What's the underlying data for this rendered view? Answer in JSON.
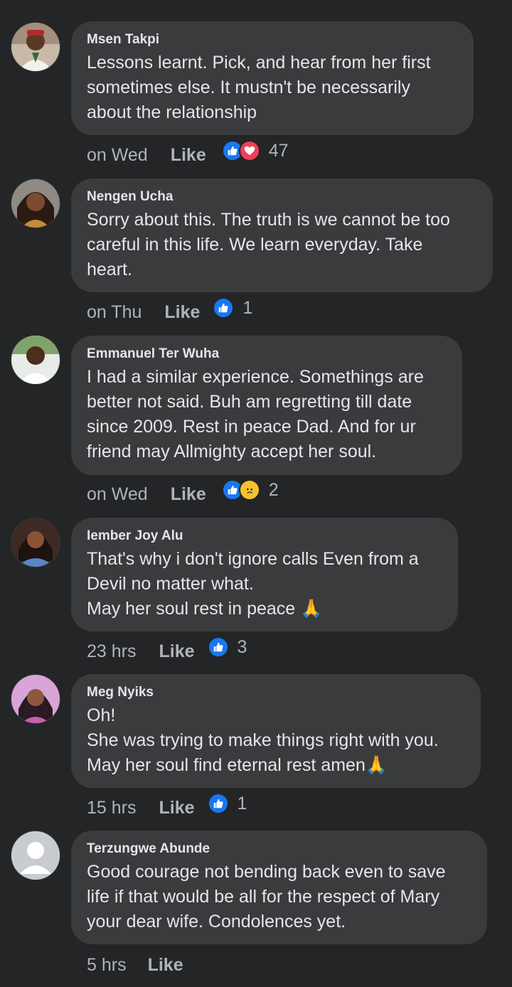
{
  "comments": [
    {
      "author": "Msen Takpi",
      "text": "Lessons learnt. Pick, and hear from her first\nsometimes else. It mustn't be necessarily\nabout the relationship",
      "time": "on Wed",
      "like_label": "Like",
      "reactions": [
        "like-icon",
        "love-icon"
      ],
      "reaction_count": "47"
    },
    {
      "author": "Nengen Ucha",
      "text": "Sorry about this. The truth is we cannot be too\ncareful in this life. We learn everyday. Take\nheart.",
      "time": "on Thu",
      "like_label": "Like",
      "reactions": [
        "like-icon"
      ],
      "reaction_count": "1"
    },
    {
      "author": "Emmanuel Ter Wuha",
      "text": "I had a similar experience. Somethings are\nbetter not said. Buh am regretting till date\nsince 2009. Rest in peace Dad. And for ur\nfriend may Allmighty accept her soul.",
      "time": "on Wed",
      "like_label": "Like",
      "reactions": [
        "like-icon",
        "sad-icon"
      ],
      "reaction_count": "2"
    },
    {
      "author": "Iember Joy Alu",
      "text": "That's why i don't ignore calls Even from a\nDevil no matter what.\nMay her soul rest in peace 🙏",
      "time": "23 hrs",
      "like_label": "Like",
      "reactions": [
        "like-icon"
      ],
      "reaction_count": "3"
    },
    {
      "author": "Meg Nyiks",
      "text": "Oh!\nShe was trying to make things right with you.\nMay her soul find eternal rest amen🙏",
      "time": "15 hrs",
      "like_label": "Like",
      "reactions": [
        "like-icon"
      ],
      "reaction_count": "1"
    },
    {
      "author": "Terzungwe Abunde",
      "text": "Good courage not bending back even to save\nlife if that would be all for the respect of Mary\nyour dear wife. Condolences yet.",
      "time": "5 hrs",
      "like_label": "Like",
      "reactions": [],
      "reaction_count": ""
    }
  ],
  "colors": {
    "background": "#232527",
    "bubble": "#3a3b3c",
    "like_blue": "#1877f2",
    "love_red": "#f33e58",
    "sad_yellow": "#f7c12e"
  }
}
